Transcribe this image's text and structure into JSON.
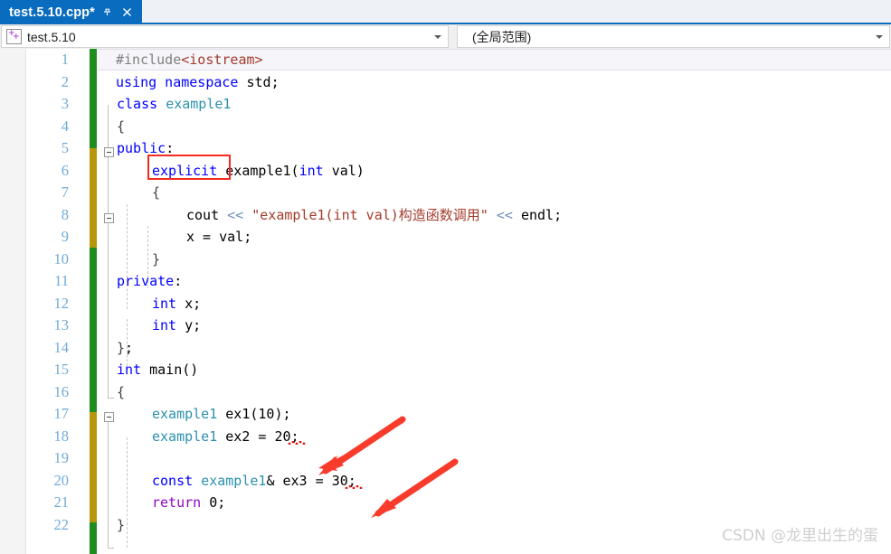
{
  "window": {
    "tab": {
      "title": "test.5.10.cpp*",
      "pin_icon": "pin-icon",
      "close_icon": "close-icon"
    }
  },
  "navbar": {
    "project_combo": {
      "icon": "cpp-file-icon",
      "value": "test.5.10",
      "caret_icon": "chevron-down-icon"
    },
    "scope_combo": {
      "value": "(全局范围)",
      "caret_icon": "chevron-down-icon"
    }
  },
  "editor": {
    "current_line": 20,
    "colors": {
      "changed_saved": "#1e8c1e",
      "changed_unsaved": "#b8960c",
      "line_number": "#70abd6",
      "keyword": "#0000ff",
      "type": "#2b91af",
      "string": "#a33b2a",
      "preprocessor": "#808080",
      "control": "#8f08c4",
      "annotation_red": "#f22b1e",
      "current_line_bg": "#f5f5fa"
    },
    "lines": [
      {
        "n": "1",
        "text": "#include<iostream>"
      },
      {
        "n": "2",
        "text": "using namespace std;"
      },
      {
        "n": "3",
        "text": "class example1"
      },
      {
        "n": "4",
        "text": "{"
      },
      {
        "n": "5",
        "text": "public:"
      },
      {
        "n": "6",
        "text": "    explicit example1(int val)"
      },
      {
        "n": "7",
        "text": "    {"
      },
      {
        "n": "8",
        "text": "        cout << \"example1(int val)构造函数调用\" << endl;"
      },
      {
        "n": "9",
        "text": "        x = val;"
      },
      {
        "n": "10",
        "text": "    }"
      },
      {
        "n": "11",
        "text": "private:"
      },
      {
        "n": "12",
        "text": "    int x;"
      },
      {
        "n": "13",
        "text": "    int y;"
      },
      {
        "n": "14",
        "text": "};"
      },
      {
        "n": "15",
        "text": "int main()"
      },
      {
        "n": "16",
        "text": "{"
      },
      {
        "n": "17",
        "text": "    example1 ex1(10);"
      },
      {
        "n": "18",
        "text": "    example1 ex2 = 20;"
      },
      {
        "n": "19",
        "text": ""
      },
      {
        "n": "20",
        "text": "    const example1& ex3 = 30;"
      },
      {
        "n": "21",
        "text": "    return 0;"
      },
      {
        "n": "22",
        "text": "}"
      }
    ],
    "annotations": {
      "highlight_box_token": "explicit",
      "arrow_1_target": "20;",
      "arrow_2_target": "30;",
      "error_squiggle_tokens": [
        "20",
        "30"
      ]
    }
  },
  "watermark": {
    "text": "CSDN @龙里出生的蛋"
  }
}
